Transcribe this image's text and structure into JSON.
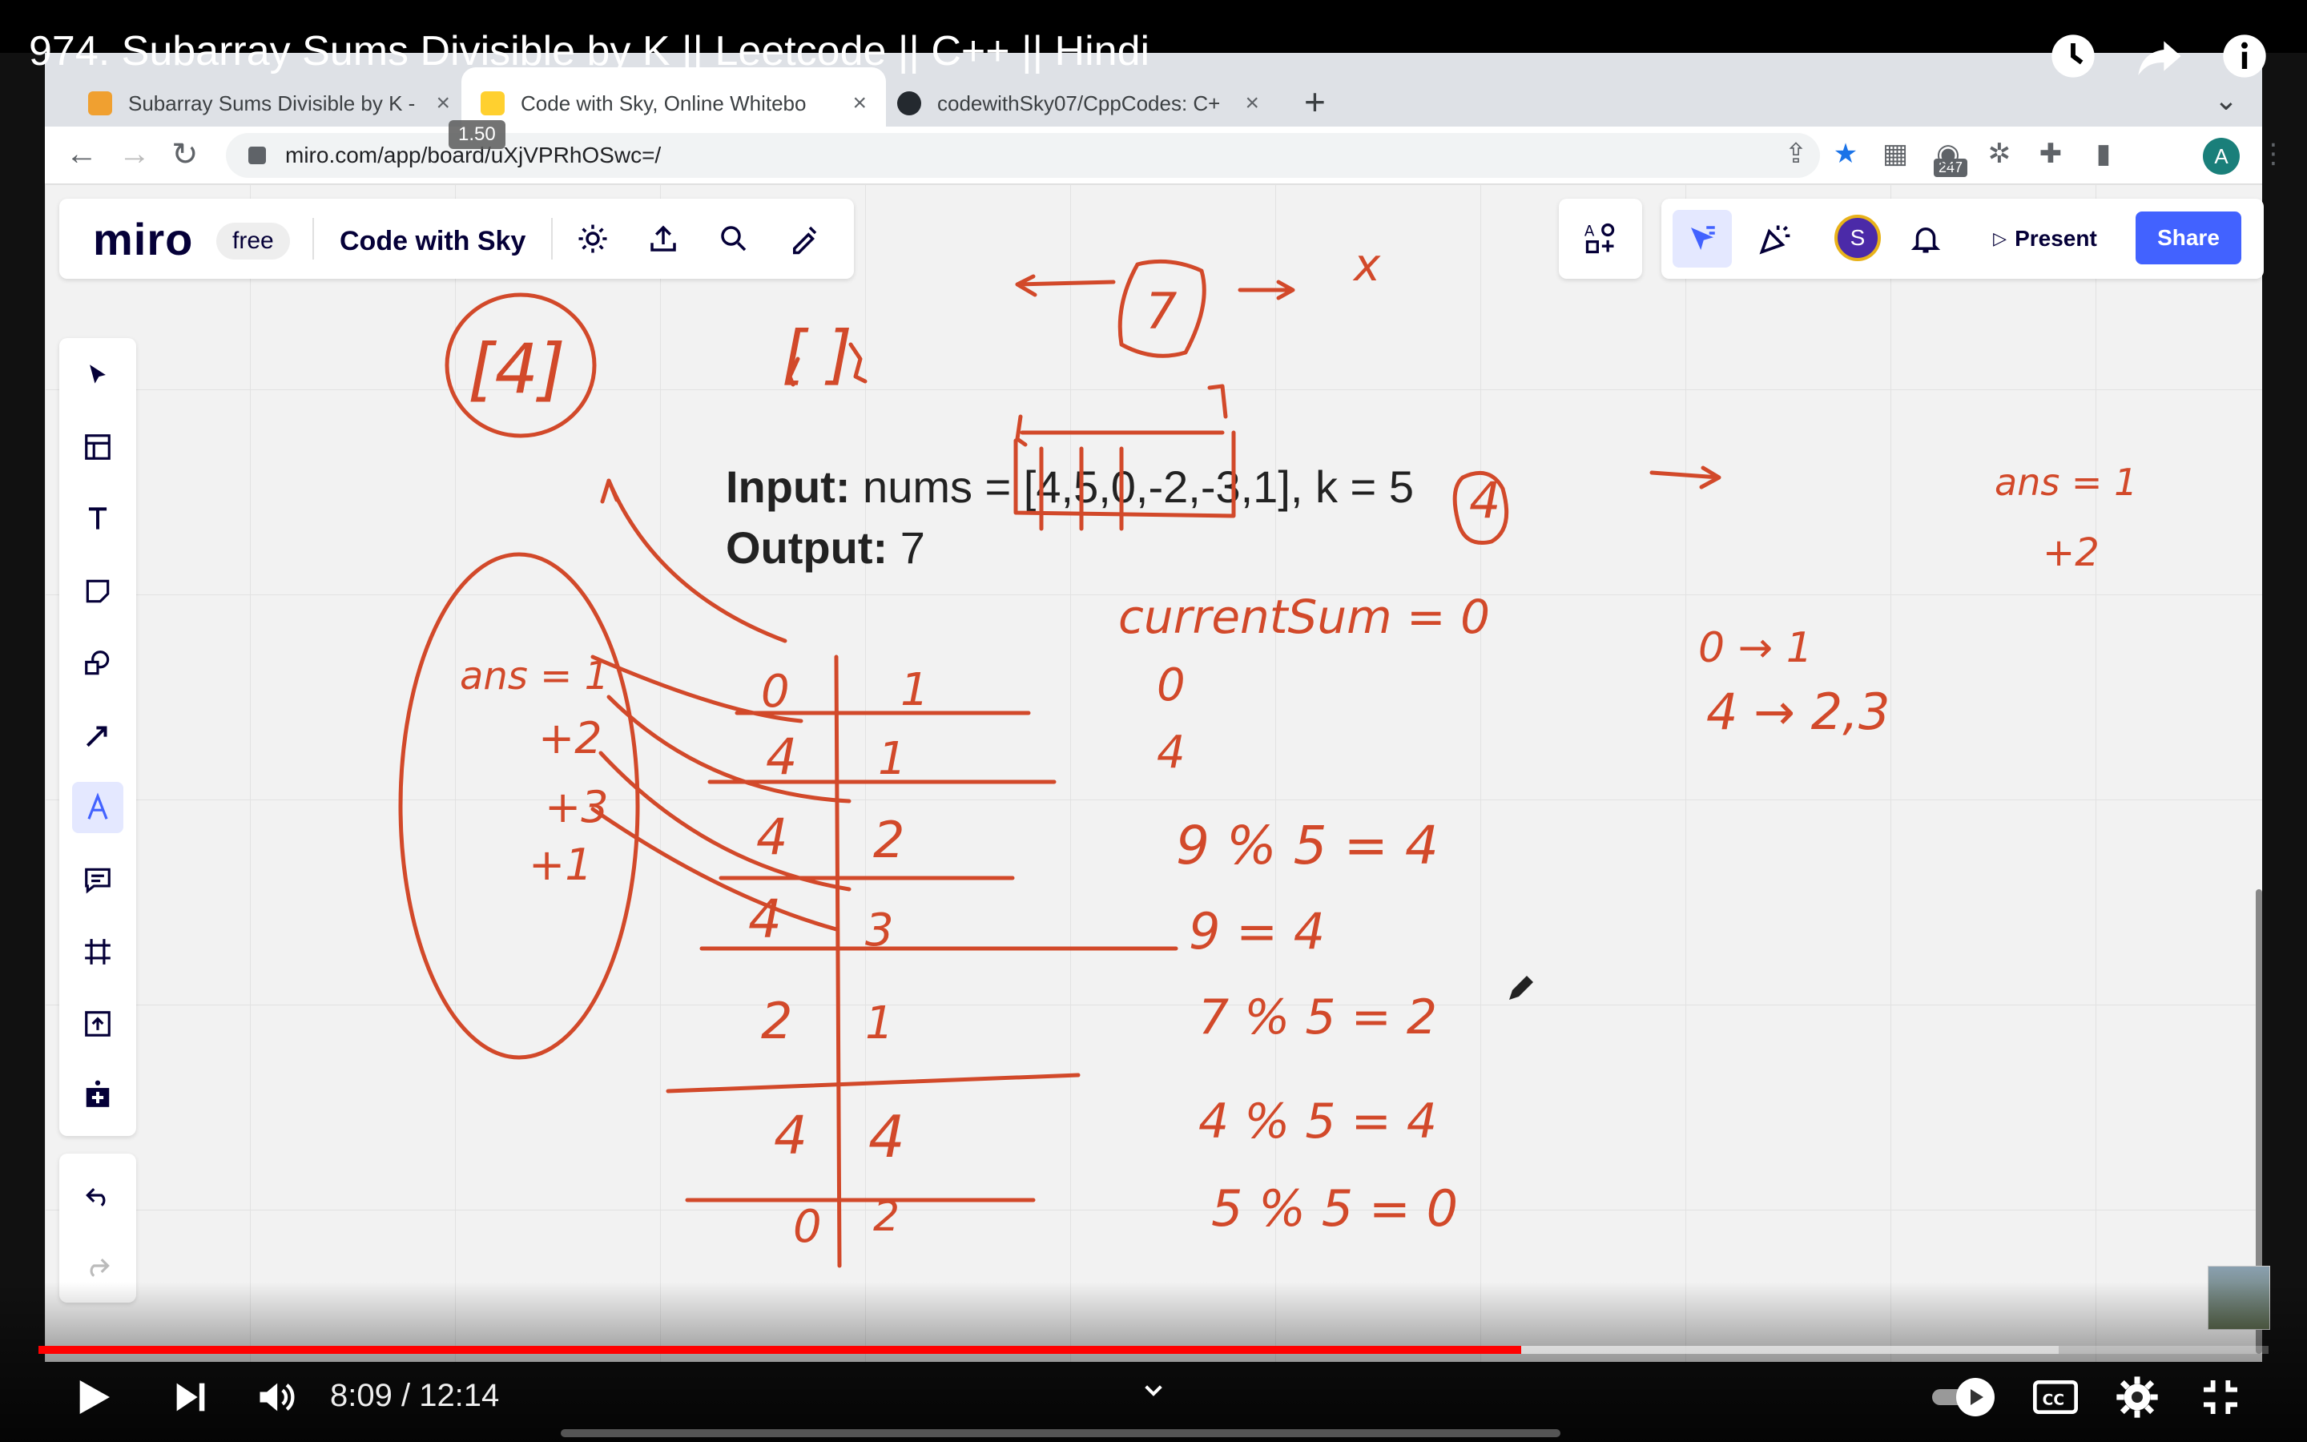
{
  "video": {
    "title": "974. Subarray Sums Divisible by K || Leetcode || C++ || Hindi",
    "time_display": "8:09 / 12:14",
    "progress_fraction": 0.665,
    "buffered_fraction": 0.906,
    "speed_tooltip": "1.50"
  },
  "browser": {
    "tabs": [
      {
        "label": "Subarray Sums Divisible by K - ",
        "favicon_color": "#f0a030",
        "active": false
      },
      {
        "label": "Code with Sky, Online Whitebo",
        "favicon_color": "#ffd02f",
        "active": true
      },
      {
        "label": "codewithSky07/CppCodes: C+",
        "favicon_color": "#24292f",
        "active": false
      }
    ],
    "url": "miro.com/app/board/uXjVPRhOSwc=/",
    "extension_badge": "247",
    "profile_initial": "A"
  },
  "miro": {
    "logo": "miro",
    "plan": "free",
    "board_name": "Code with Sky",
    "avatar_initial": "S",
    "present_label": "Present",
    "share_label": "Share",
    "brand_color": "#4262ff"
  },
  "problem": {
    "input_label": "Input:",
    "input_value": "nums = [4,5,0,-2,-3,1], k = 5",
    "output_label": "Output:",
    "output_value": "7"
  },
  "ink_notes": {
    "ans_left": [
      "ans = 1",
      "+2",
      "+3",
      "+1"
    ],
    "table_left_col": [
      "0",
      "4",
      "4",
      "4",
      "2",
      "4",
      "0"
    ],
    "table_right_col": [
      "1",
      "1",
      "2",
      "3",
      "1",
      "4",
      "2"
    ],
    "current_sum": "currentSum = 0",
    "calc_lines": [
      "0",
      "4",
      "9 % 5 = 4",
      "9 = 4",
      "7 % 5 = 2",
      "4 % 5 = 4",
      "5 % 5 = 0"
    ],
    "map_right": [
      "0 → 1",
      "4 → 2,3"
    ],
    "ans_right": [
      "ans = 1",
      "+2"
    ],
    "bracket_top": "[4]",
    "empty_bracket": "[ ]",
    "circled_7": "7",
    "circled_4": "4",
    "x_mark": "x"
  }
}
